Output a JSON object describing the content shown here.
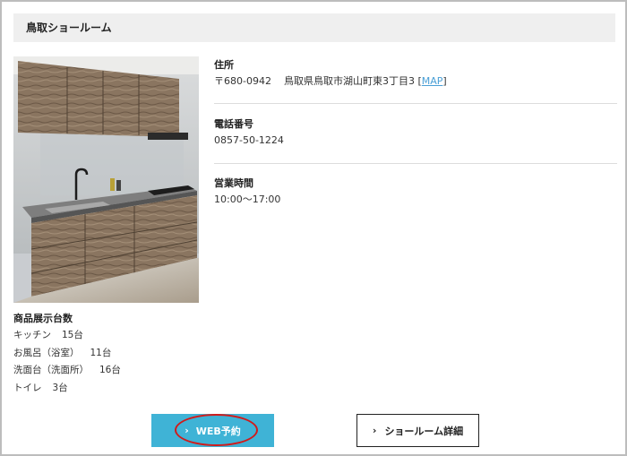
{
  "showroom": {
    "name": "鳥取ショールーム"
  },
  "photo": {
    "alt": "kitchen-photo"
  },
  "exhibit": {
    "title": "商品展示台数",
    "items": [
      {
        "label": "キッチン",
        "count": "15台"
      },
      {
        "label": "お風呂（浴室）",
        "count": "11台"
      },
      {
        "label": "洗面台（洗面所）",
        "count": "16台"
      },
      {
        "label": "トイレ",
        "count": "3台"
      }
    ]
  },
  "address": {
    "label": "住所",
    "postal": "〒680-0942",
    "street": "鳥取県鳥取市湖山町東3丁目3",
    "bracket_open": "[",
    "map_link": "MAP",
    "bracket_close": "]"
  },
  "phone": {
    "label": "電話番号",
    "value": "0857-50-1224"
  },
  "hours": {
    "label": "営業時間",
    "value": "10:00〜17:00"
  },
  "buttons": {
    "web_reserve": "WEB予約",
    "showroom_detail": "ショールーム詳細",
    "chevron": "›"
  },
  "colors": {
    "accent": "#3fb3d6",
    "highlight": "#d11a1a",
    "link": "#4a9fd6"
  }
}
